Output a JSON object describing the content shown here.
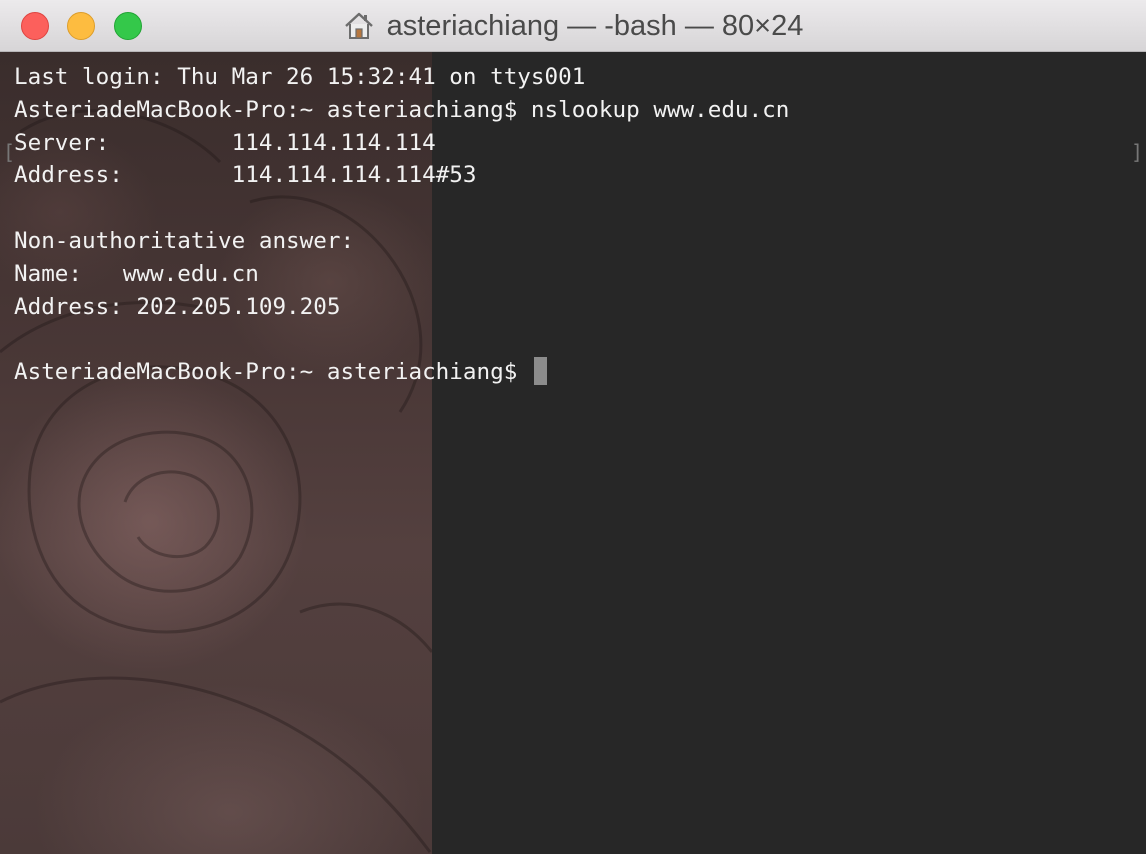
{
  "window": {
    "title": "asteriachiang — -bash — 80×24",
    "title_icon": "home-icon",
    "colors": {
      "close": "#fc605c",
      "minimize": "#fdbc40",
      "maximize": "#34c84a",
      "terminal_background": "#272727",
      "text": "#f2f2f2"
    }
  },
  "terminal": {
    "lines": [
      "Last login: Thu Mar 26 15:32:41 on ttys001",
      "AsteriadeMacBook-Pro:~ asteriachiang$ nslookup www.edu.cn",
      "Server:\t\t114.114.114.114",
      "Address:\t114.114.114.114#53",
      "",
      "Non-authoritative answer:",
      "Name:\twww.edu.cn",
      "Address: 202.205.109.205",
      "",
      "AsteriadeMacBook-Pro:~ asteriachiang$ "
    ],
    "prompt_line_index": 9,
    "cursor": "block"
  }
}
